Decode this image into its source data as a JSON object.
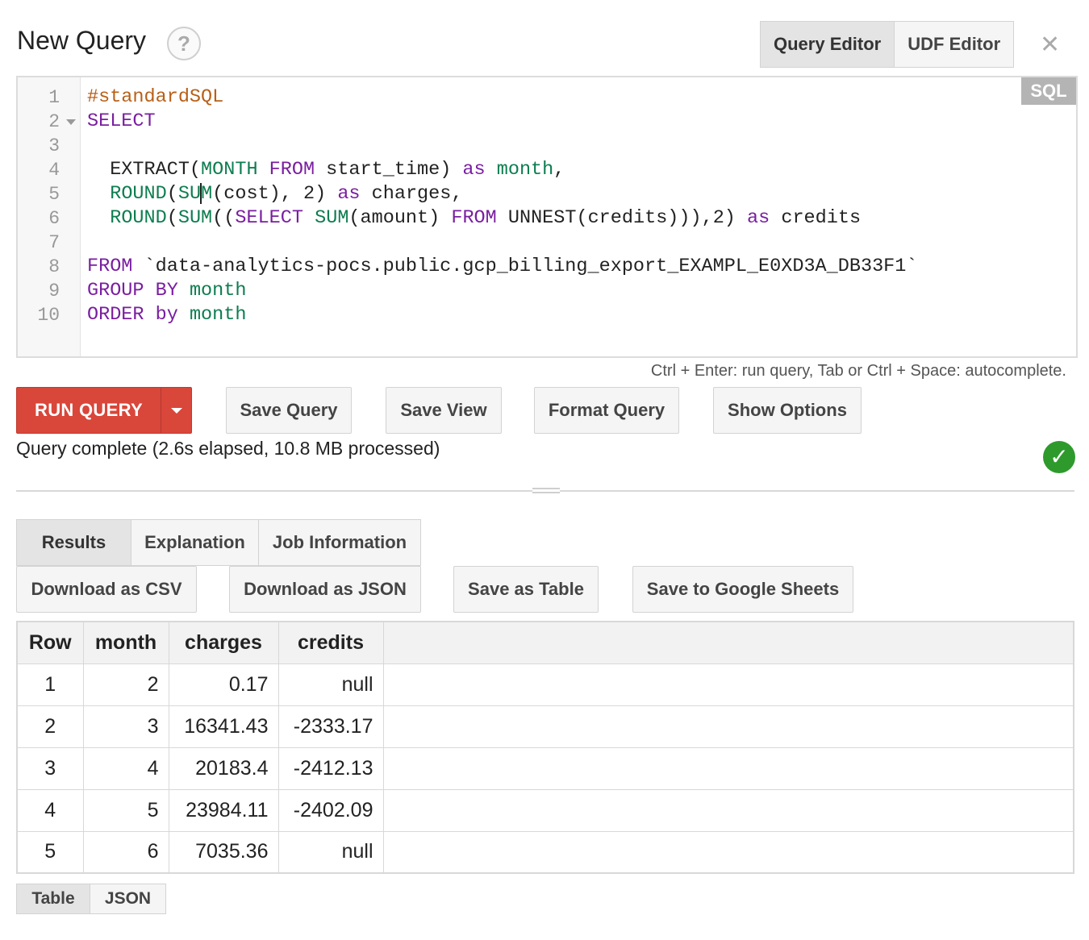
{
  "header": {
    "title": "New Query",
    "help_label": "?",
    "editor_tabs": [
      {
        "label": "Query Editor",
        "active": true
      },
      {
        "label": "UDF Editor",
        "active": false
      }
    ],
    "close_label": "✕"
  },
  "editor": {
    "language_badge": "SQL",
    "line_numbers": [
      "1",
      "2",
      "3",
      "4",
      "5",
      "6",
      "7",
      "8",
      "9",
      "10"
    ],
    "hint": "Ctrl + Enter: run query, Tab or Ctrl + Space: autocomplete."
  },
  "actions": {
    "run_label": "RUN QUERY",
    "save_query": "Save Query",
    "save_view": "Save View",
    "format_query": "Format Query",
    "show_options": "Show Options"
  },
  "status": {
    "text": "Query complete (2.6s elapsed, 10.8 MB processed)",
    "icon": "checkmark-icon",
    "color": "#2e9a2c"
  },
  "result_tabs": [
    {
      "label": "Results",
      "active": true
    },
    {
      "label": "Explanation",
      "active": false
    },
    {
      "label": "Job Information",
      "active": false
    }
  ],
  "downloads": {
    "csv": "Download as CSV",
    "json": "Download as JSON",
    "table": "Save as Table",
    "sheets": "Save to Google Sheets"
  },
  "table": {
    "headers": [
      "Row",
      "month",
      "charges",
      "credits"
    ],
    "rows": [
      [
        "1",
        "2",
        "0.17",
        "null"
      ],
      [
        "2",
        "3",
        "16341.43",
        "-2333.17"
      ],
      [
        "3",
        "4",
        "20183.4",
        "-2412.13"
      ],
      [
        "4",
        "5",
        "23984.11",
        "-2402.09"
      ],
      [
        "5",
        "6",
        "7035.36",
        "null"
      ]
    ]
  },
  "view_tabs": [
    {
      "label": "Table",
      "active": true
    },
    {
      "label": "JSON",
      "active": false
    }
  ],
  "colors": {
    "run_button": "#d9463a",
    "keyword": "#7a1ea0",
    "function": "#0d7d50",
    "comment": "#b85f17"
  }
}
